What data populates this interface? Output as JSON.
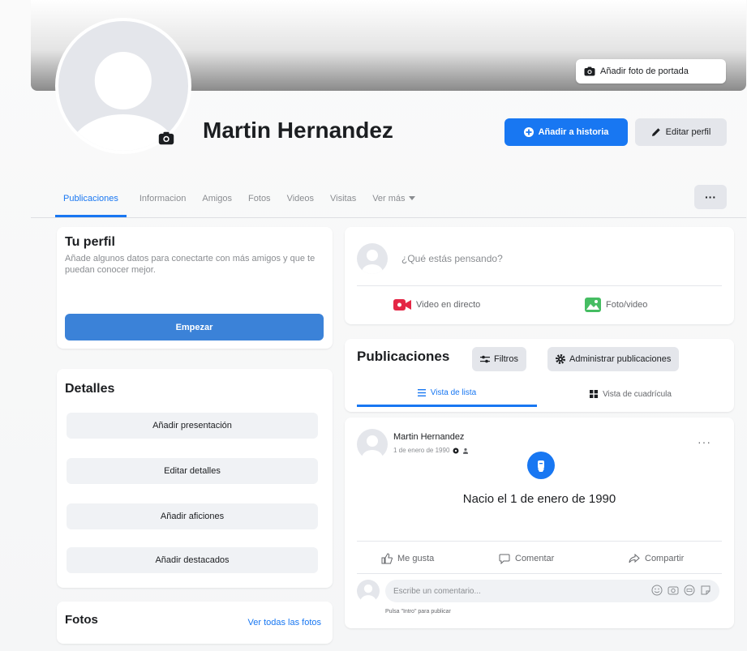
{
  "profile": {
    "name": "Martin Hernandez",
    "cover_button": "Añadir foto de portada",
    "add_story": "Añadir a historia",
    "edit_profile": "Editar perfil"
  },
  "tabs": [
    {
      "label": "Publicaciones",
      "active": true
    },
    {
      "label": "Informacion"
    },
    {
      "label": "Amigos"
    },
    {
      "label": "Fotos"
    },
    {
      "label": "Videos"
    },
    {
      "label": "Visitas"
    },
    {
      "label": "Ver más"
    }
  ],
  "tu_perfil": {
    "title": "Tu perfil",
    "description": "Añade algunos datos para conectarte con más amigos y que te puedan conocer mejor.",
    "start": "Empezar"
  },
  "detalles": {
    "title": "Detalles",
    "buttons": [
      "Añadir presentación",
      "Editar detalles",
      "Añadir aficiones",
      "Añadir destacados"
    ]
  },
  "fotos": {
    "title": "Fotos",
    "see_all": "Ver todas las fotos"
  },
  "composer": {
    "placeholder": "¿Qué estás pensando?",
    "live_video": "Video en directo",
    "photo_video": "Foto/video"
  },
  "posts": {
    "title": "Publicaciones",
    "filters": "Filtros",
    "manage": "Administrar publicaciones",
    "list_view": "Vista de lista",
    "grid_view": "Vista de cuadrícula"
  },
  "post": {
    "author": "Martin Hernandez",
    "date": "1 de enero de 1990",
    "event_text": "Nacio el 1 de enero de 1990",
    "like": "Me gusta",
    "comment": "Comentar",
    "share": "Compartir",
    "comment_placeholder": "Escribe un comentario...",
    "comment_hint": "Pulsa \"Intro\" para publicar"
  },
  "colors": {
    "accent": "#1877f2",
    "button_grey": "#e4e6eb",
    "text_muted": "#8a8d91",
    "live_red": "#e42645",
    "photo_green": "#45bd62"
  }
}
